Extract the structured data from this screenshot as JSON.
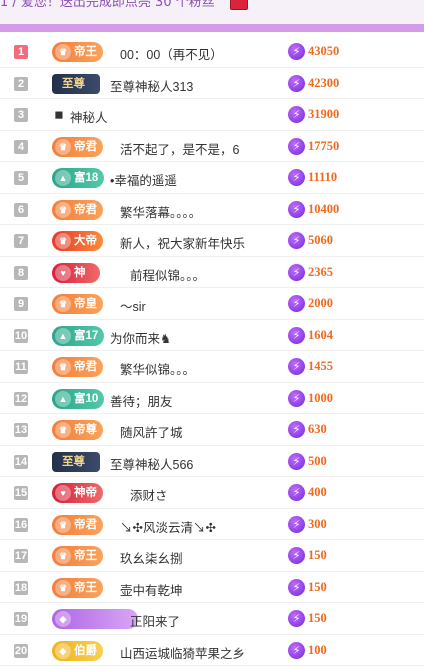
{
  "header": {
    "notice_text": "1 / 爱您！送出完成即点亮 30 个粉丝"
  },
  "colors": {
    "accent_purple": "#d49be8",
    "score_orange": "#f06a1d",
    "rank_first": "#f26b7a",
    "rank_default": "#b7b7b7"
  },
  "rows": [
    {
      "rank": "1",
      "badge": "帝王",
      "badge_style": "orange",
      "name": "00：00（再不见）",
      "score": "43050"
    },
    {
      "rank": "2",
      "badge": "至尊",
      "badge_style": "dark",
      "name": "至尊神秘人313",
      "score": "42300"
    },
    {
      "rank": "3",
      "badge": "",
      "badge_style": "spy",
      "name": "神秘人",
      "score": "31900"
    },
    {
      "rank": "4",
      "badge": "帝君",
      "badge_style": "orange",
      "name": "活不起了，是不是，6",
      "score": "17750"
    },
    {
      "rank": "5",
      "badge": "富18",
      "badge_style": "teal",
      "name": "•幸福的遥遥",
      "score": "11110"
    },
    {
      "rank": "6",
      "badge": "帝君",
      "badge_style": "orange",
      "name": "繁华落幕。。。。",
      "score": "10400"
    },
    {
      "rank": "7",
      "badge": "大帝",
      "badge_style": "red2",
      "name": "新人，祝大家新年快乐",
      "score": "5060"
    },
    {
      "rank": "8",
      "badge": "神",
      "badge_style": "red",
      "name": "前程似锦。。。",
      "score": "2365"
    },
    {
      "rank": "9",
      "badge": "帝皇",
      "badge_style": "orange",
      "name": "～sir",
      "score": "2000"
    },
    {
      "rank": "10",
      "badge": "富17",
      "badge_style": "teal",
      "name": "为你而来♞",
      "score": "1604"
    },
    {
      "rank": "11",
      "badge": "帝君",
      "badge_style": "orange",
      "name": "繁华似锦。。。",
      "score": "1455"
    },
    {
      "rank": "12",
      "badge": "富10",
      "badge_style": "teal",
      "name": "善待；朋友",
      "score": "1000"
    },
    {
      "rank": "13",
      "badge": "帝尊",
      "badge_style": "orange",
      "name": "随风許了城",
      "score": "630"
    },
    {
      "rank": "14",
      "badge": "至尊",
      "badge_style": "dark",
      "name": "至尊神秘人566",
      "score": "500"
    },
    {
      "rank": "15",
      "badge": "神帝",
      "badge_style": "red",
      "name": "添财さ",
      "score": "400"
    },
    {
      "rank": "16",
      "badge": "帝君",
      "badge_style": "orange",
      "name": "↘✣风淡云清↘✣",
      "score": "300"
    },
    {
      "rank": "17",
      "badge": "帝王",
      "badge_style": "orange",
      "name": "玖幺柒幺捌",
      "score": "150"
    },
    {
      "rank": "18",
      "badge": "帝王",
      "badge_style": "orange",
      "name": "壶中有乾坤",
      "score": "150"
    },
    {
      "rank": "19",
      "badge": "",
      "badge_style": "purple",
      "name": "正阳来了",
      "score": "150"
    },
    {
      "rank": "20",
      "badge": "伯爵",
      "badge_style": "gold",
      "name": "山西运城临猗苹果之乡",
      "score": "100"
    }
  ]
}
